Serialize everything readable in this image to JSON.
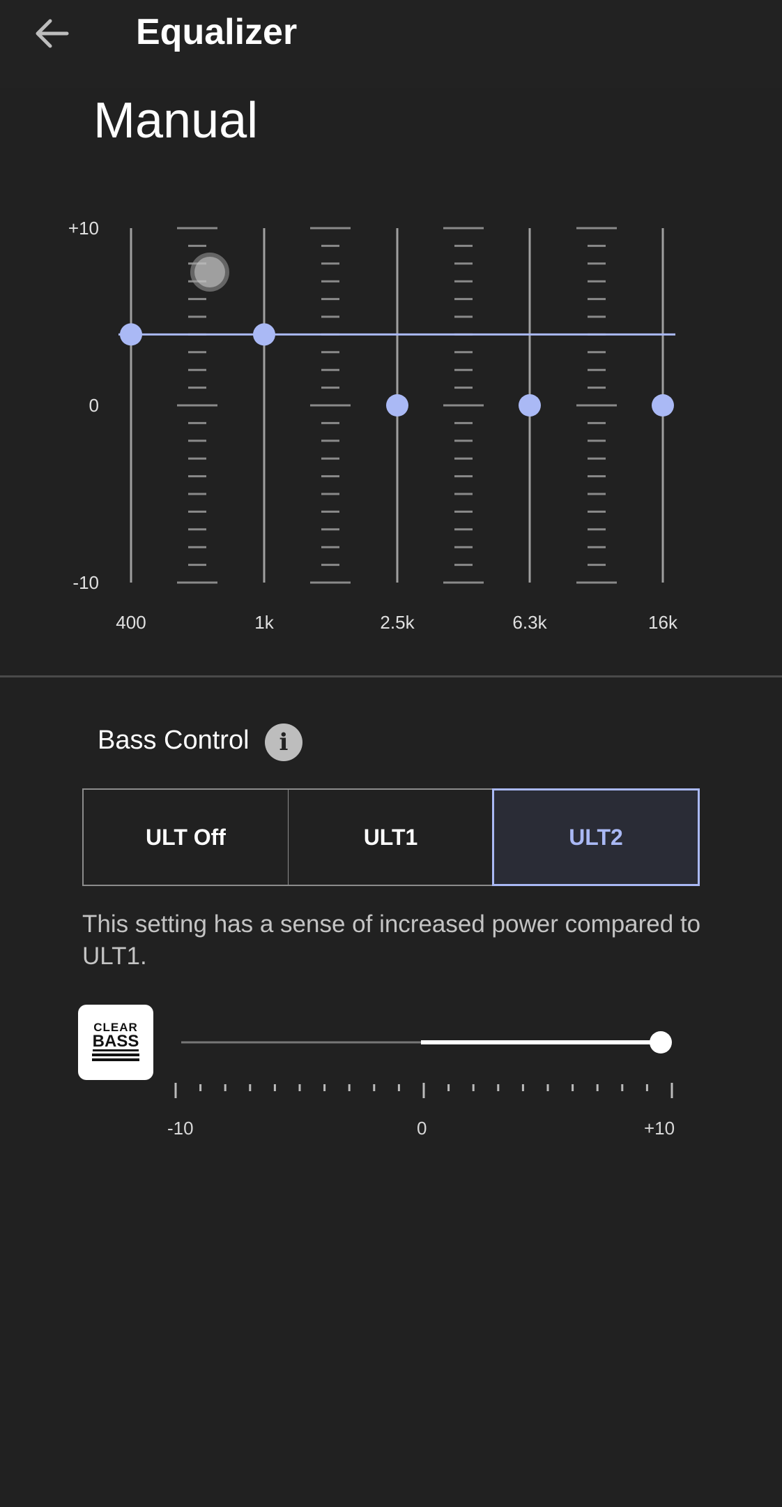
{
  "header": {
    "title": "Equalizer",
    "back_icon": "arrow-left-icon"
  },
  "preset": {
    "name": "Manual"
  },
  "equalizer": {
    "y_labels": {
      "max": "+10",
      "mid": "0",
      "min": "-10"
    },
    "range": [
      -10,
      10
    ],
    "bands": [
      {
        "label": "400",
        "value": 4
      },
      {
        "label": "1k",
        "value": 4
      },
      {
        "label": "2.5k",
        "value": 0
      },
      {
        "label": "6.3k",
        "value": 0
      },
      {
        "label": "16k",
        "value": 0
      }
    ],
    "accent_color": "#aab9f5"
  },
  "bass_control": {
    "title": "Bass Control",
    "info_icon": "info-icon",
    "options": [
      "ULT Off",
      "ULT1",
      "ULT2"
    ],
    "selected": "ULT2",
    "description": "This setting has a sense of increased power compared to ULT1."
  },
  "clear_bass": {
    "logo_line1": "CLEAR",
    "logo_line2": "BASS",
    "range": [
      -10,
      10
    ],
    "value": 10,
    "labels": {
      "min": "-10",
      "mid": "0",
      "max": "+10"
    }
  }
}
